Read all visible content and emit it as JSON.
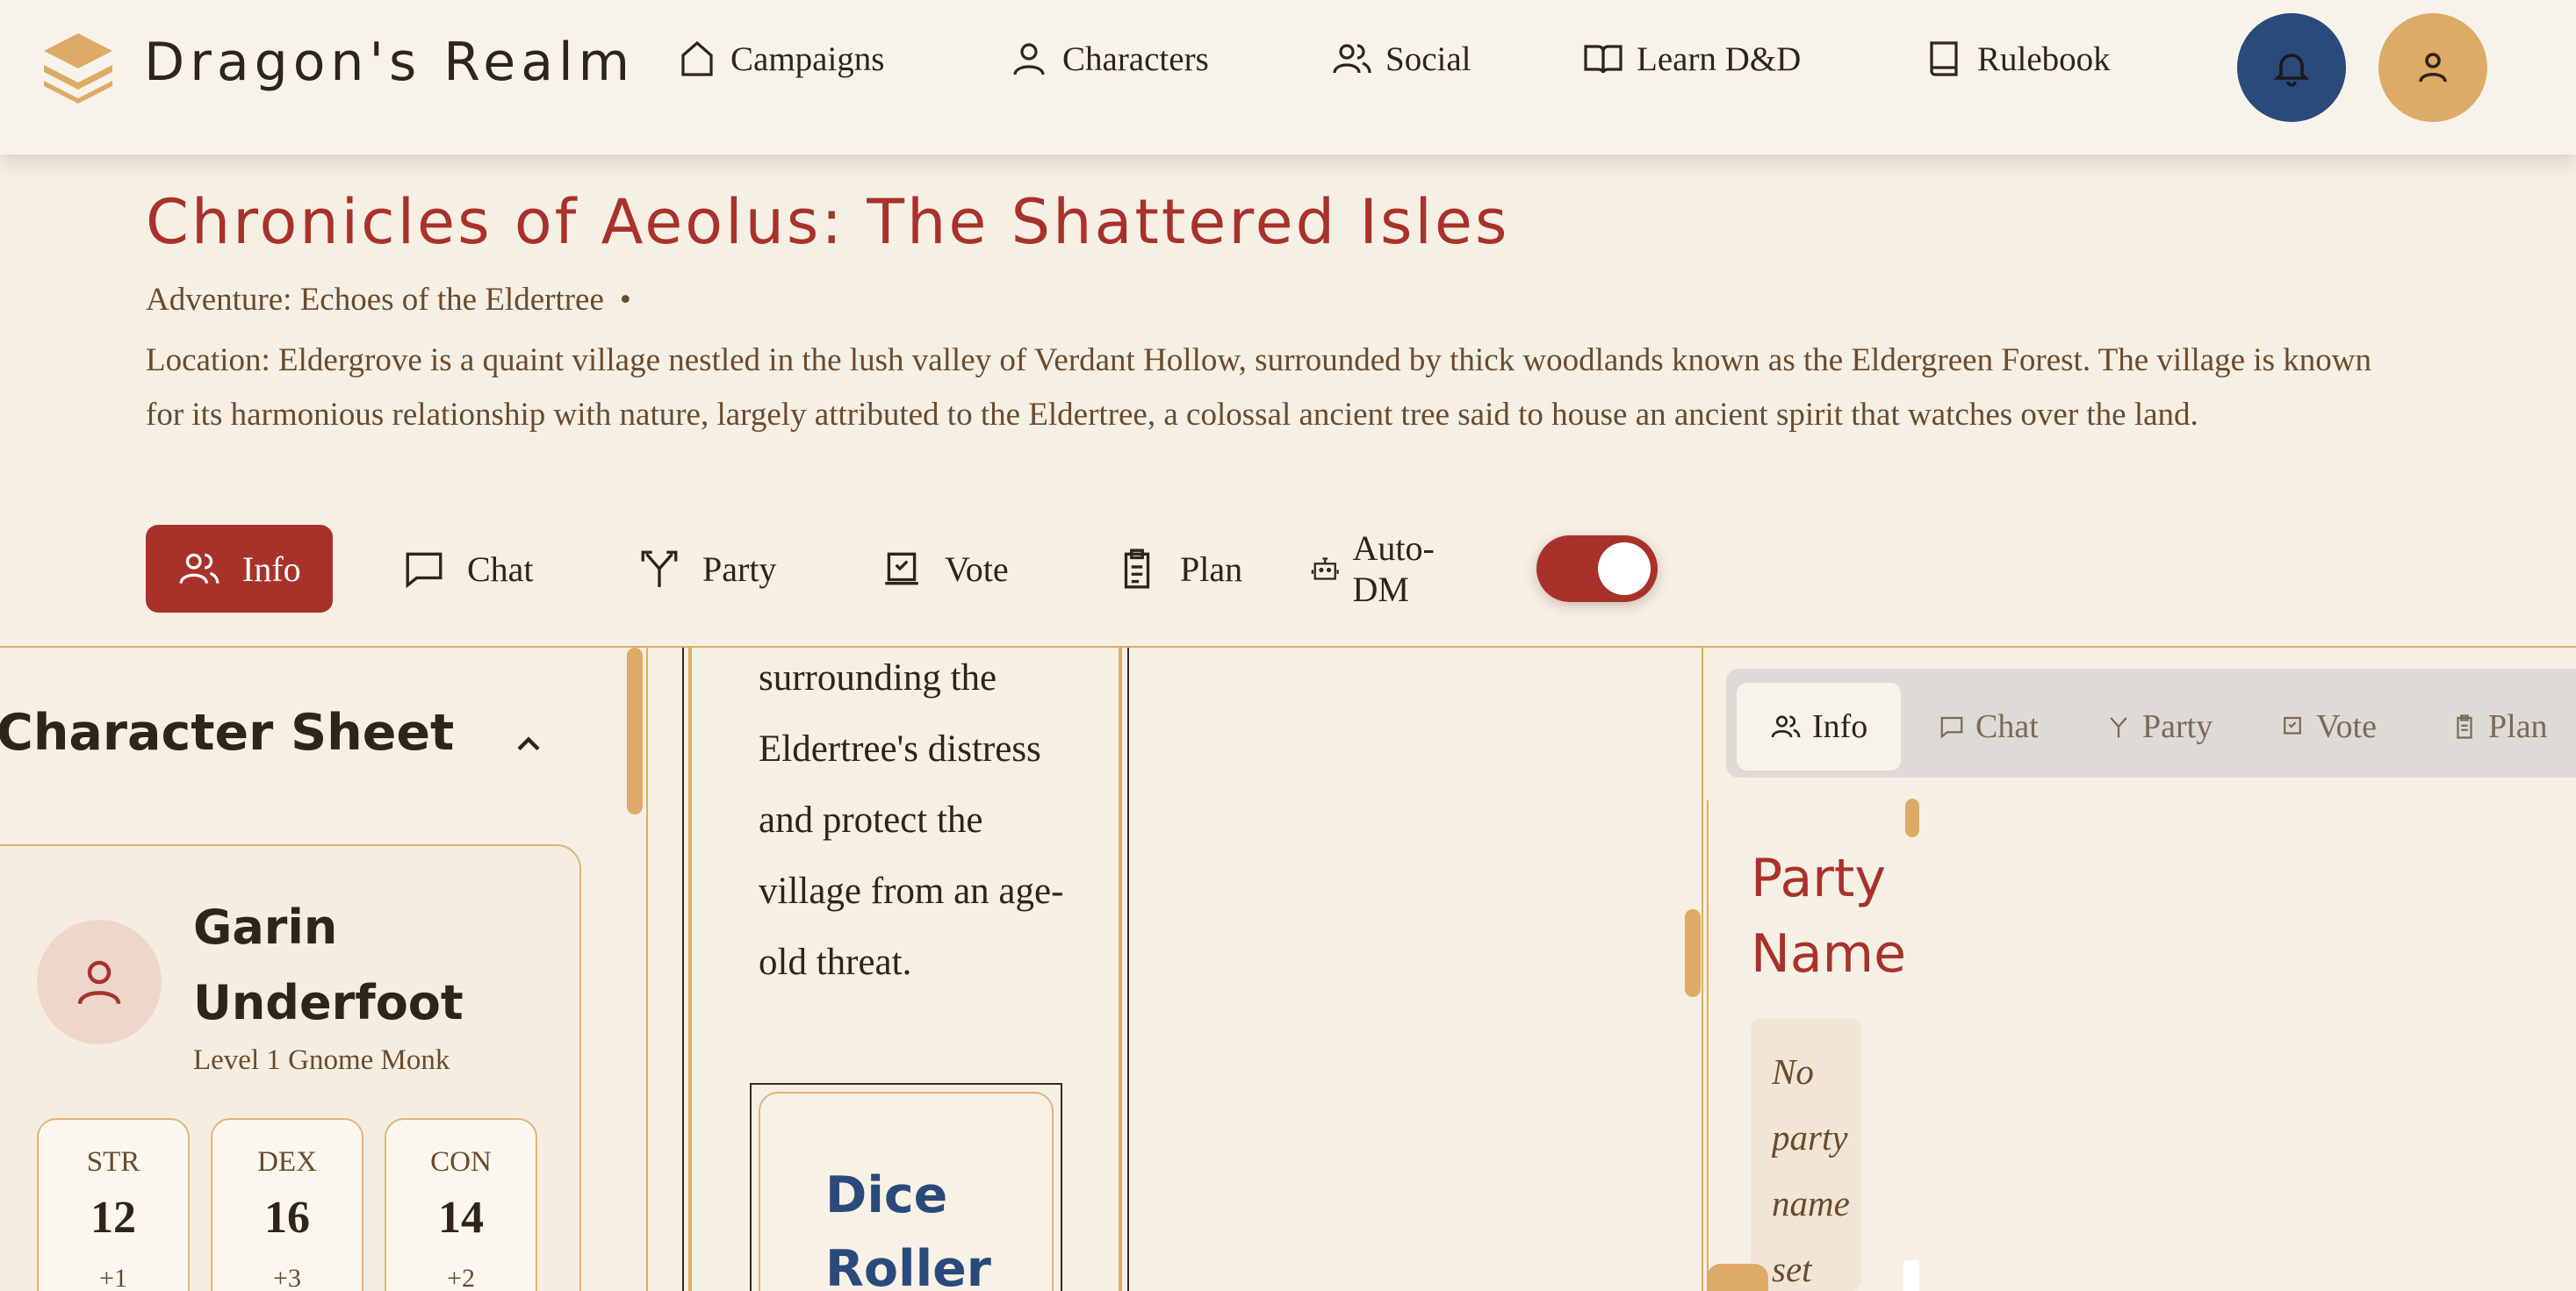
{
  "app": {
    "name": "Dragon's Realm"
  },
  "nav": {
    "items": [
      {
        "label": "Campaigns",
        "icon": "home-icon"
      },
      {
        "label": "Characters",
        "icon": "user-icon"
      },
      {
        "label": "Social",
        "icon": "users-icon"
      },
      {
        "label": "Learn D&D",
        "icon": "open-book-icon"
      },
      {
        "label": "Rulebook",
        "icon": "book-icon"
      }
    ],
    "notifications_icon": "bell-icon",
    "profile_icon": "user-icon"
  },
  "campaign": {
    "title": "Chronicles of Aeolus: The Shattered Isles",
    "adventure": "Adventure: Echoes of the Eldertree",
    "separator": "•",
    "location": "Location: Eldergrove is a quaint village nestled in the lush valley of Verdant Hollow, surrounded by thick woodlands known as the Eldergreen Forest. The village is known for its harmonious relationship with nature, largely attributed to the Eldertree, a colossal ancient tree said to house an ancient spirit that watches over the land."
  },
  "tabs": {
    "items": [
      {
        "label": "Info",
        "icon": "users-icon",
        "active": true
      },
      {
        "label": "Chat",
        "icon": "message-icon",
        "active": false
      },
      {
        "label": "Party",
        "icon": "split-arrow-icon",
        "active": false
      },
      {
        "label": "Vote",
        "icon": "ballot-check-icon",
        "active": false
      },
      {
        "label": "Plan",
        "icon": "clipboard-icon",
        "active": false
      }
    ],
    "auto_dm_label": "Auto-DM",
    "auto_dm_enabled": true
  },
  "character_sheet": {
    "title": "Character Sheet",
    "name": "Garin Underfoot",
    "class_line": "Level 1 Gnome Monk",
    "stats": [
      {
        "label": "STR",
        "value": "12",
        "mod": "+1"
      },
      {
        "label": "DEX",
        "value": "16",
        "mod": "+3"
      },
      {
        "label": "CON",
        "value": "14",
        "mod": "+2"
      }
    ]
  },
  "quest_panel": {
    "text": "surrounding the Eldertree's distress and protect the village from an age-old threat.",
    "dice_roller_title": "Dice Roller"
  },
  "side_panel": {
    "tabs": [
      {
        "label": "Info",
        "active": true
      },
      {
        "label": "Chat",
        "active": false
      },
      {
        "label": "Party",
        "active": false
      },
      {
        "label": "Vote",
        "active": false
      },
      {
        "label": "Plan",
        "active": false
      }
    ],
    "party_name_title": "Party Name",
    "party_name_empty": "No party name set"
  },
  "colors": {
    "accent_red": "#a8322a",
    "navy": "#2a4a7c",
    "gold": "#ddab66",
    "background": "#f5efe4"
  }
}
